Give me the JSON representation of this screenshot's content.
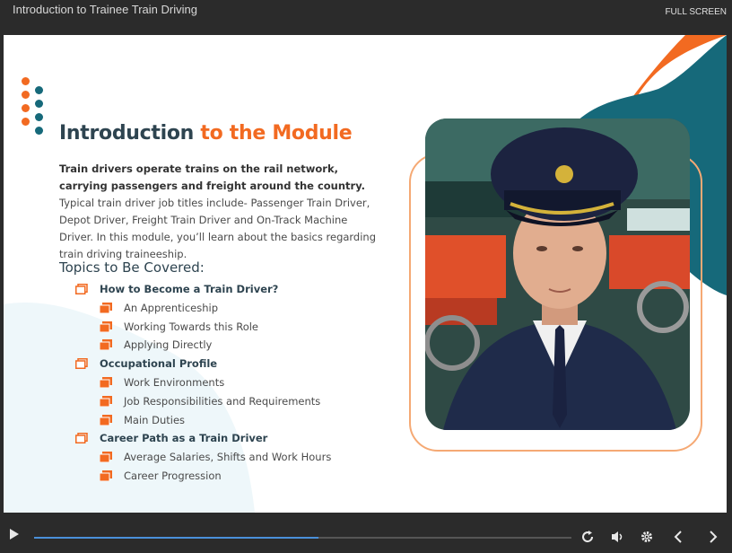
{
  "app": {
    "title": "Introduction to Trainee Train Driving",
    "fullscreen_label": "FULL SCREEN"
  },
  "slide": {
    "heading_part1": "Introduction ",
    "heading_part2": "to the Module",
    "intro_bold": "Train drivers operate trains on the rail network, carrying passengers and freight around the country.",
    "intro_rest": " Typical train driver job titles include- Passenger Train Driver, Depot Driver, Freight Train Driver and On-Track Machine Driver. In this module, you’ll learn about the basics regarding train driving traineeship.",
    "topics_title": "Topics to Be Covered:",
    "topics": [
      {
        "label": "How to Become a Train Driver?",
        "level": "main"
      },
      {
        "label": "An Apprenticeship",
        "level": "sub"
      },
      {
        "label": "Working Towards this Role",
        "level": "sub"
      },
      {
        "label": "Applying Directly",
        "level": "sub"
      },
      {
        "label": "Occupational Profile",
        "level": "main"
      },
      {
        "label": "Work Environments",
        "level": "sub"
      },
      {
        "label": "Job Responsibilities and Requirements",
        "level": "sub"
      },
      {
        "label": "Main Duties",
        "level": "sub"
      },
      {
        "label": "Career Path as a Train Driver",
        "level": "main"
      },
      {
        "label": "Average Salaries, Shifts and Work Hours",
        "level": "sub"
      },
      {
        "label": "Career Progression",
        "level": "sub"
      }
    ],
    "photo": "train-driver-in-uniform-photo"
  },
  "player": {
    "progress": 0.53,
    "controls": [
      "play-icon",
      "replay-icon",
      "volume-icon",
      "settings-icon",
      "prev-icon",
      "next-icon"
    ]
  },
  "colors": {
    "accent": "#f26a21",
    "teal": "#16697a",
    "heading": "#2e4450",
    "player_bg": "#2b2b2b",
    "progress": "#4a90d9"
  }
}
